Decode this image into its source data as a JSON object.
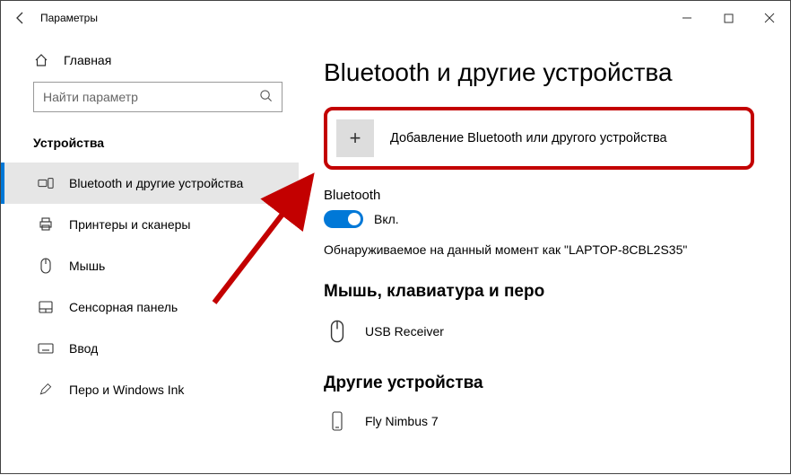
{
  "titlebar": {
    "title": "Параметры"
  },
  "sidebar": {
    "home_label": "Главная",
    "search_placeholder": "Найти параметр",
    "group_label": "Устройства",
    "items": [
      {
        "label": "Bluetooth и другие устройства"
      },
      {
        "label": "Принтеры и сканеры"
      },
      {
        "label": "Мышь"
      },
      {
        "label": "Сенсорная панель"
      },
      {
        "label": "Ввод"
      },
      {
        "label": "Перо и Windows Ink"
      }
    ]
  },
  "main": {
    "heading": "Bluetooth и другие устройства",
    "add_device_label": "Добавление Bluetooth или другого устройства",
    "bt_section_label": "Bluetooth",
    "bt_toggle_label": "Вкл.",
    "discoverable_line": "Обнаруживаемое на данный момент как \"LAPTOP-8CBL2S35\"",
    "mouse_kb_section": "Мышь, клавиатура и перо",
    "device1_label": "USB Receiver",
    "other_section": "Другие устройства",
    "device2_label": "Fly Nimbus 7"
  }
}
